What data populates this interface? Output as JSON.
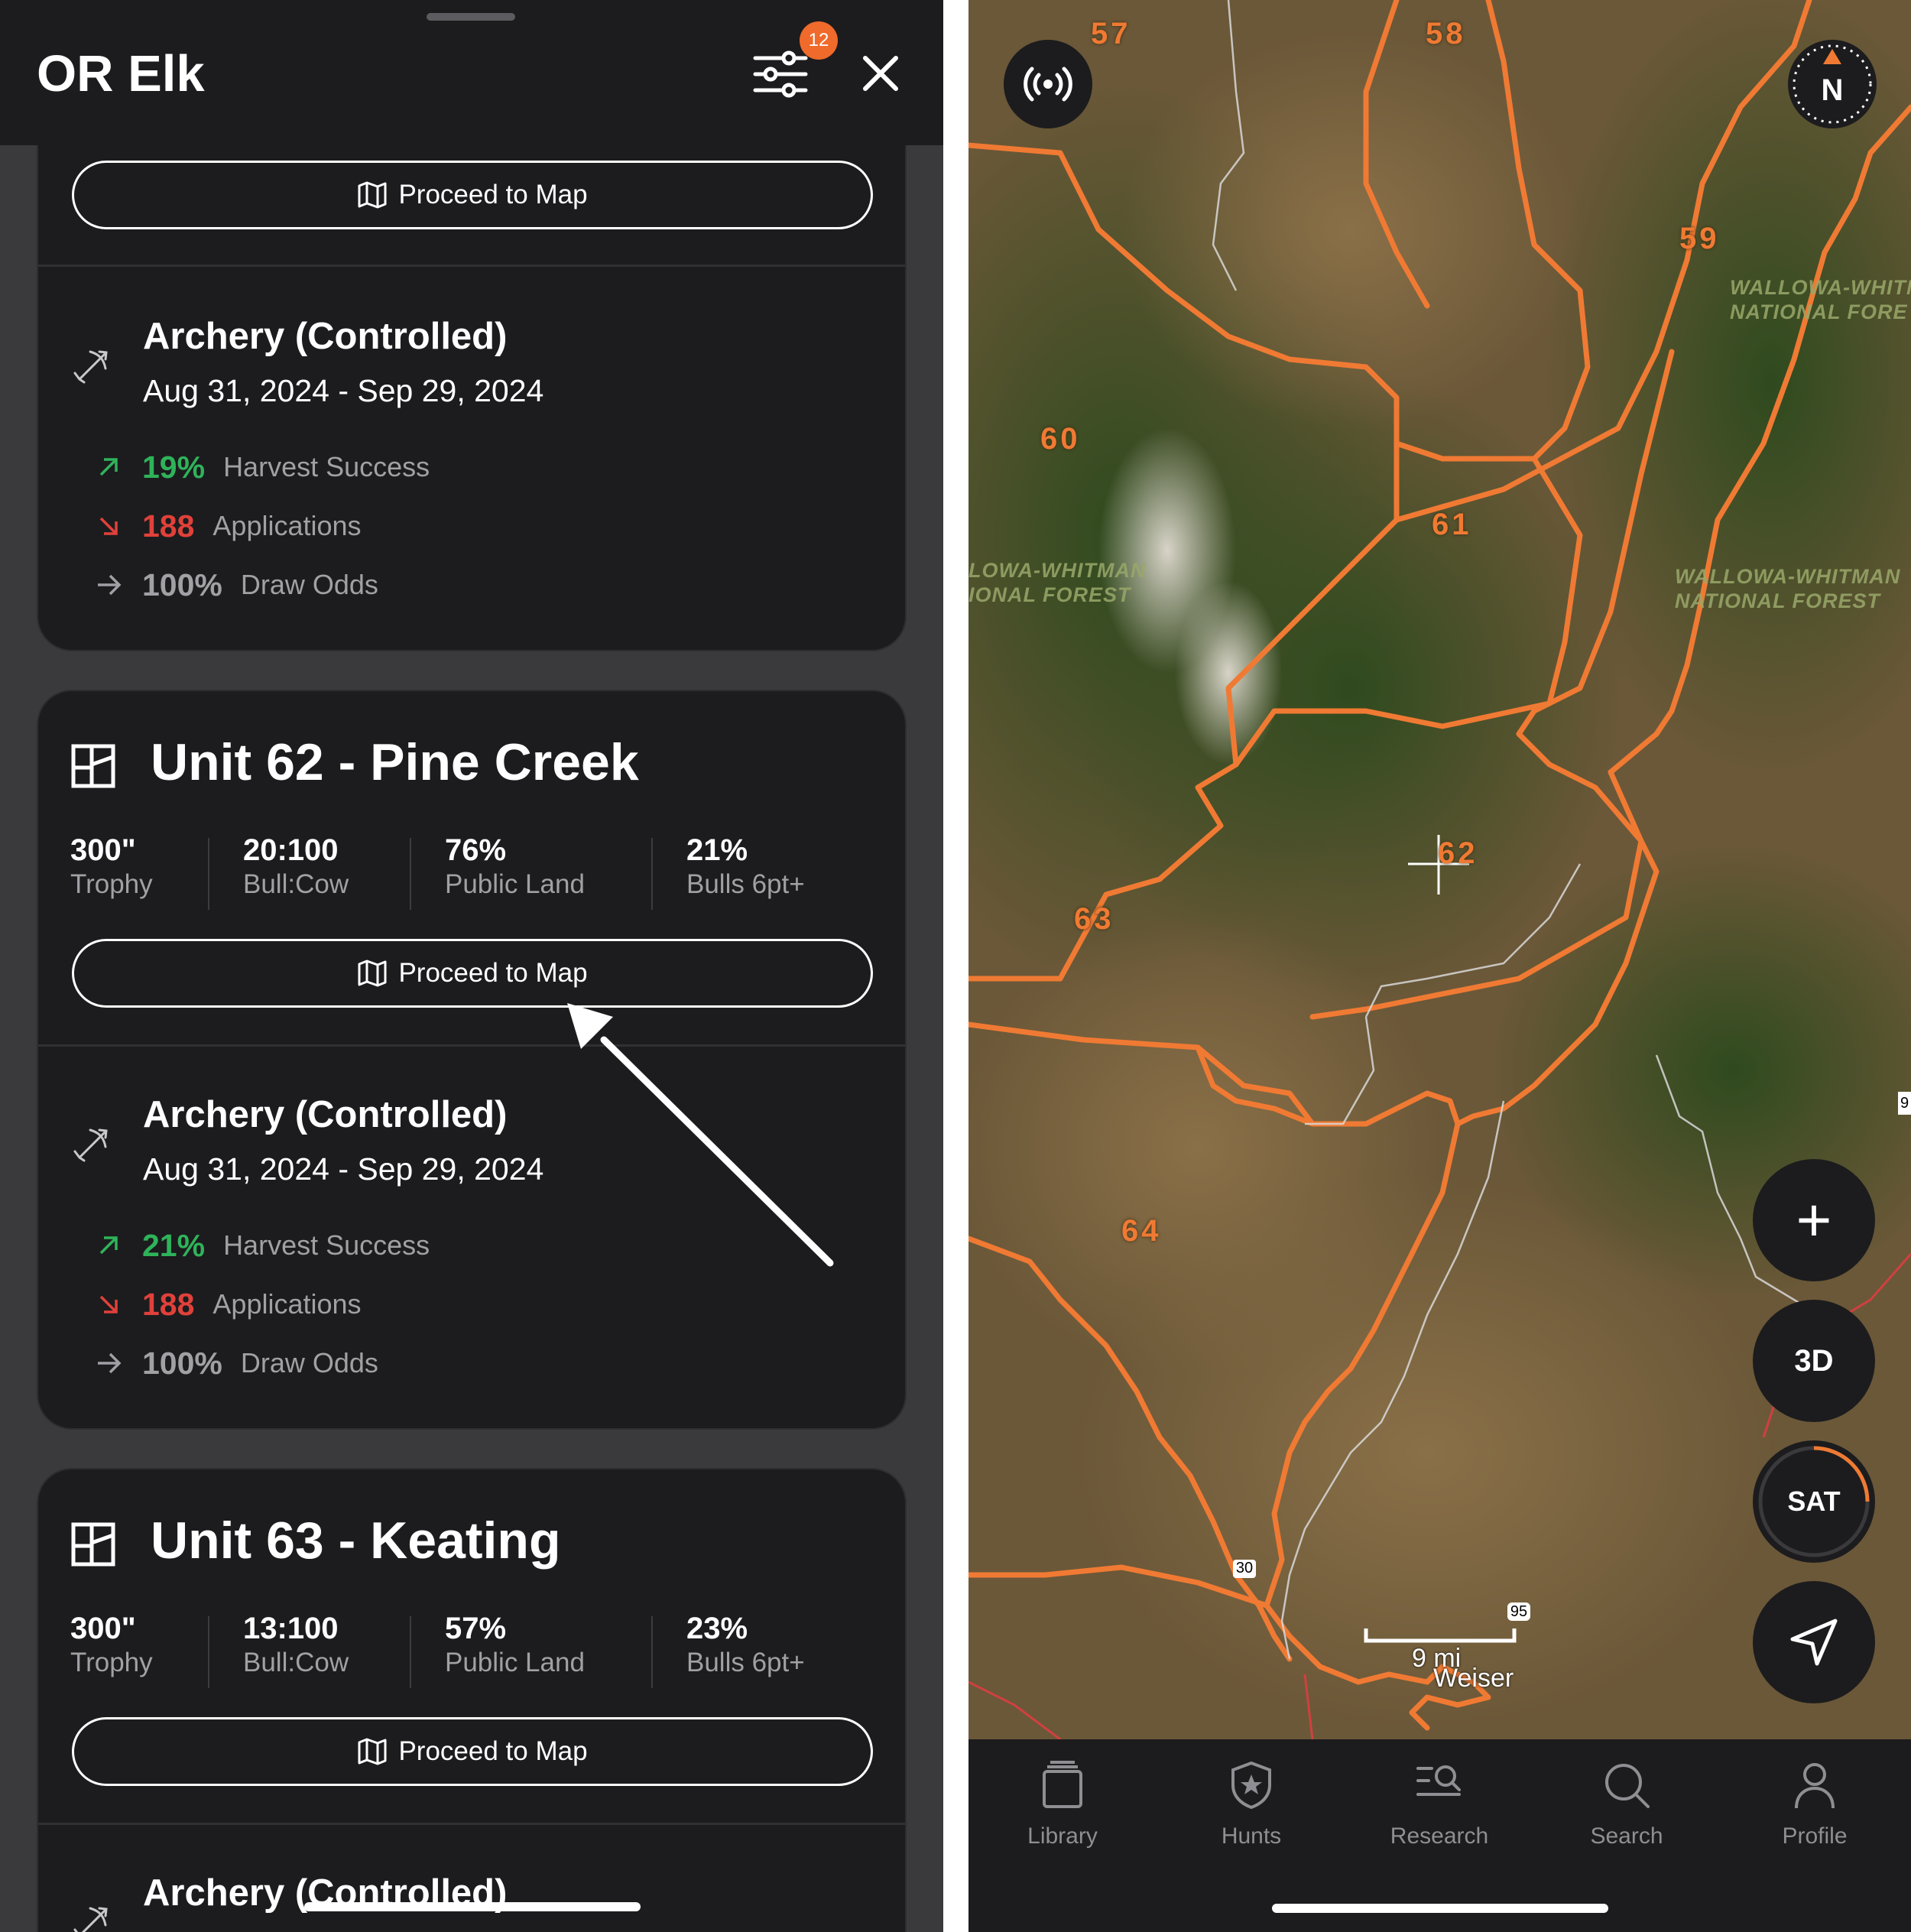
{
  "sheet": {
    "title": "OR Elk",
    "filter_badge": "12"
  },
  "proceed_label": "Proceed to Map",
  "seasons": [
    {
      "title": "Archery (Controlled)",
      "dates": "Aug 31, 2024 - Sep 29, 2024",
      "harvest_value": "19%",
      "harvest_label": "Harvest Success",
      "apps_value": "188",
      "apps_label": "Applications",
      "odds_value": "100%",
      "odds_label": "Draw Odds"
    },
    {
      "title": "Archery (Controlled)",
      "dates": "Aug 31, 2024 - Sep 29, 2024",
      "harvest_value": "21%",
      "harvest_label": "Harvest Success",
      "apps_value": "188",
      "apps_label": "Applications",
      "odds_value": "100%",
      "odds_label": "Draw Odds"
    },
    {
      "title": "Archery (Controlled)"
    }
  ],
  "units": [
    {
      "title": "Unit 62 - Pine Creek",
      "metrics": [
        {
          "value": "300\"",
          "label": "Trophy"
        },
        {
          "value": "20:100",
          "label": "Bull:Cow"
        },
        {
          "value": "76%",
          "label": "Public Land"
        },
        {
          "value": "21%",
          "label": "Bulls 6pt+"
        }
      ]
    },
    {
      "title": "Unit 63 - Keating",
      "metrics": [
        {
          "value": "300\"",
          "label": "Trophy"
        },
        {
          "value": "13:100",
          "label": "Bull:Cow"
        },
        {
          "value": "57%",
          "label": "Public Land"
        },
        {
          "value": "23%",
          "label": "Bulls 6pt+"
        }
      ]
    }
  ],
  "colors": {
    "accent_orange": "#ef6a2b",
    "success_green": "#2fb35a",
    "danger_red": "#e0413a",
    "card_bg": "#1c1c1e",
    "sheet_bg": "#3a3a3c"
  },
  "map": {
    "unit_labels": [
      "57",
      "58",
      "59",
      "60",
      "61",
      "62",
      "63",
      "64"
    ],
    "forest_labels": [
      "WALLOWA-WHITM\nNATIONAL FORE",
      "LOWA-WHITMAN\nIONAL FOREST",
      "WALLOWA-WHITMAN\nNATIONAL FOREST"
    ],
    "compass_label": "N",
    "zoom_in": "+",
    "three_d": "3D",
    "layer": "SAT",
    "scale_label": "9 mi",
    "town": "Weiser",
    "route_30": "30",
    "route_95": "95",
    "edge_marker": "9"
  },
  "tabs": [
    {
      "label": "Library",
      "icon": "library-icon"
    },
    {
      "label": "Hunts",
      "icon": "hunts-shield-icon"
    },
    {
      "label": "Research",
      "icon": "research-icon"
    },
    {
      "label": "Search",
      "icon": "search-icon"
    },
    {
      "label": "Profile",
      "icon": "profile-icon"
    }
  ]
}
